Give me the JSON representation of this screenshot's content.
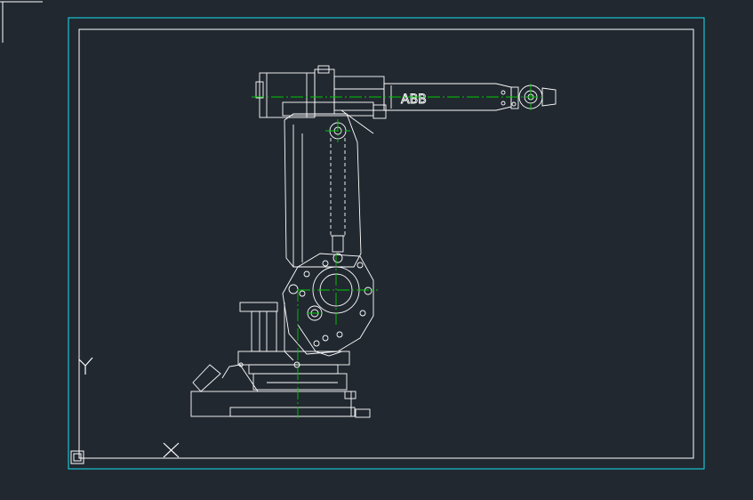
{
  "drawing": {
    "brand_label": "ABB",
    "colors": {
      "background": "#212830",
      "geometry": "#ffffff",
      "viewport_border": "#19c3d2",
      "centerline": "#00c800"
    }
  },
  "ucs_icon": {
    "y_axis_label": "Y",
    "x_axis_label": "X"
  }
}
